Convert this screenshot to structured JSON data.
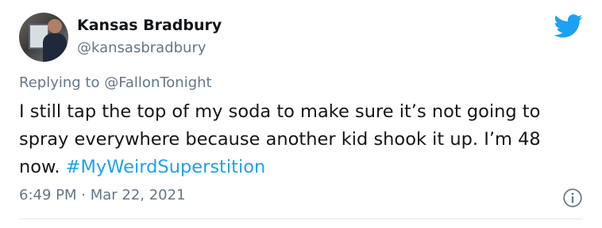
{
  "author": {
    "name": "Kansas Bradbury",
    "handle": "@kansasbradbury"
  },
  "reply": {
    "prefix": "Replying to ",
    "mention": "@FallonTonight"
  },
  "tweet": {
    "text": "I still tap the top of my soda to make sure it’s not going to spray everywhere because another kid shook it up. I’m 48 now. ",
    "hashtag": "#MyWeirdSuperstition"
  },
  "meta": {
    "timestamp": "6:49 PM · Mar 22, 2021"
  },
  "icons": {
    "brand": "twitter-bird-icon",
    "info": "info-icon"
  },
  "colors": {
    "brand": "#1da1f2",
    "secondary_text": "#657786",
    "primary_text": "#14171a"
  }
}
